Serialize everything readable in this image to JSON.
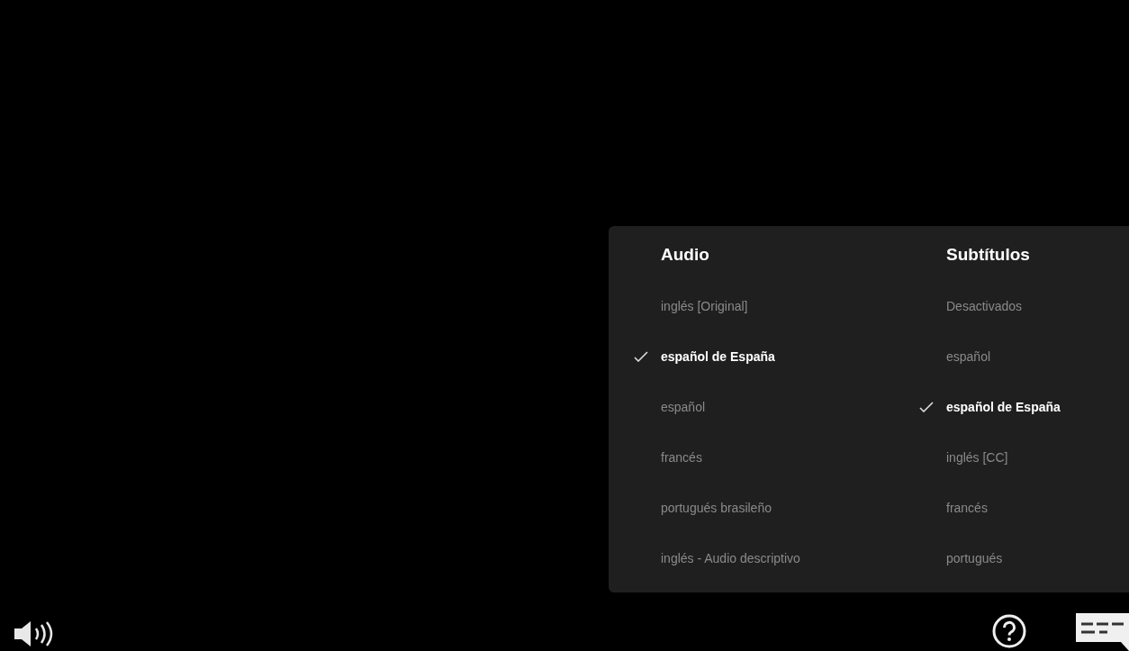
{
  "audio_subtitles_panel": {
    "columns": [
      {
        "heading": "Audio",
        "options": [
          {
            "label": "inglés [Original]",
            "selected": false
          },
          {
            "label": "español de España",
            "selected": true
          },
          {
            "label": "español",
            "selected": false
          },
          {
            "label": "francés",
            "selected": false
          },
          {
            "label": "portugués brasileño",
            "selected": false
          },
          {
            "label": "inglés - Audio descriptivo",
            "selected": false
          }
        ]
      },
      {
        "heading": "Subtítulos",
        "options": [
          {
            "label": "Desactivados",
            "selected": false
          },
          {
            "label": "español",
            "selected": false
          },
          {
            "label": "español de España",
            "selected": true
          },
          {
            "label": "inglés [CC]",
            "selected": false
          },
          {
            "label": "francés",
            "selected": false
          },
          {
            "label": "portugués",
            "selected": false
          }
        ]
      }
    ]
  }
}
